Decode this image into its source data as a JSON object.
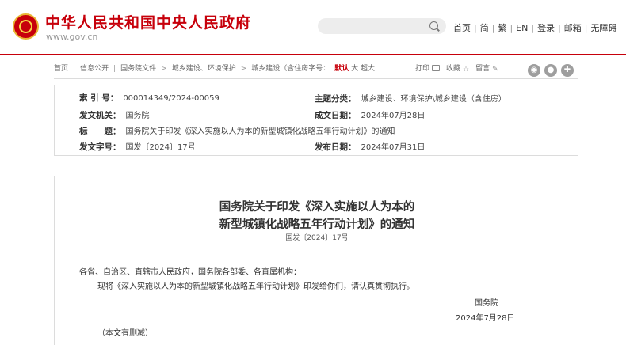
{
  "header": {
    "site_title": "中华人民共和国中央人民政府",
    "site_url": "www.gov.cn",
    "search_placeholder": "",
    "links": [
      "首页",
      "简",
      "繁",
      "EN",
      "登录",
      "邮箱",
      "无障碍"
    ]
  },
  "breadcrumb": {
    "items": [
      "首页",
      "信息公开",
      "国务院文件",
      "城乡建设、环境保护",
      "城乡建设（含住房字号："
    ],
    "font_size_label": "默认",
    "font_size_options": [
      "大",
      "超大"
    ]
  },
  "tools": {
    "print": "打印",
    "favorite": "收藏",
    "comment": "留言"
  },
  "meta": {
    "index_label": "索 引 号：",
    "index_value": "000014349/2024-00059",
    "category_label": "主题分类：",
    "category_value": "城乡建设、环境保护\\城乡建设（含住房）",
    "issuer_label": "发文机关：",
    "issuer_value": "国务院",
    "written_label": "成文日期：",
    "written_value": "2024年07月28日",
    "title_label": "标　　题：",
    "title_value": "国务院关于印发《深入实施以人为本的新型城镇化战略五年行动计划》的通知",
    "docno_label": "发文字号：",
    "docno_value": "国发〔2024〕17号",
    "published_label": "发布日期：",
    "published_value": "2024年07月31日"
  },
  "document": {
    "title_line1": "国务院关于印发《深入实施以人为本的",
    "title_line2": "新型城镇化战略五年行动计划》的通知",
    "number": "国发〔2024〕17号",
    "recipients": "各省、自治区、直辖市人民政府，国务院各部委、各直属机构：",
    "body": "现将《深入实施以人为本的新型城镇化战略五年行动计划》印发给你们，请认真贯彻执行。",
    "signature": "国务院",
    "date": "2024年7月28日",
    "note": "（本文有删减）"
  },
  "colors": {
    "brand_red": "#c7000b"
  }
}
